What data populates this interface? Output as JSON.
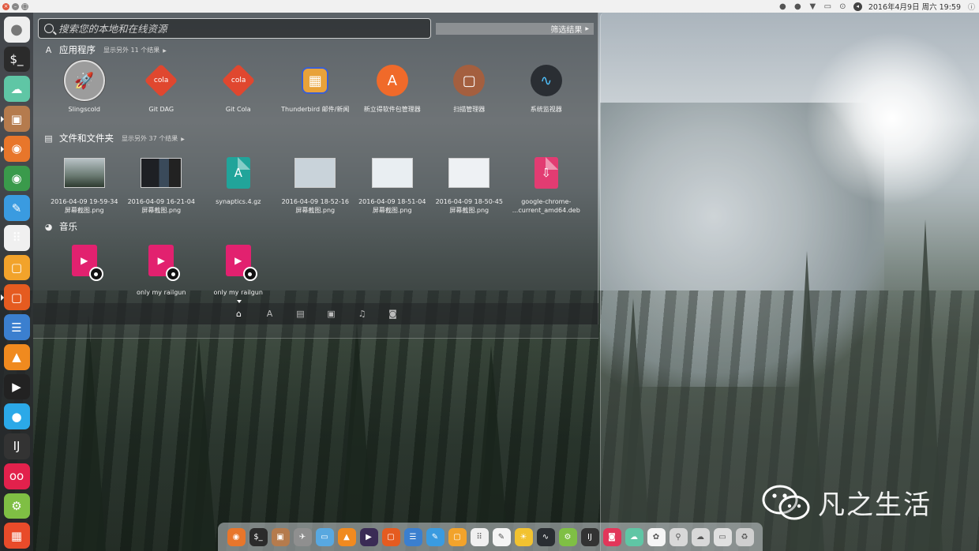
{
  "top_panel": {
    "datetime": "2016年4月9日 周六 19:59",
    "window_buttons": [
      "close-icon",
      "minimize-icon",
      "maximize-icon"
    ],
    "indicators": [
      "ime-icon",
      "chat-icon",
      "wifi-icon",
      "battery-icon",
      "input-method-icon",
      "volume-icon",
      "power-icon"
    ]
  },
  "search": {
    "placeholder": "搜索您的本地和在线资源",
    "filter_label": "筛选结果"
  },
  "applications": {
    "title": "应用程序",
    "more": "显示另外 11 个结果",
    "items": [
      {
        "label": "Slingscold",
        "icon": "rocket-icon",
        "color": "#9c9c9c"
      },
      {
        "label": "Git DAG",
        "icon": "git-icon",
        "color": "#e0472f"
      },
      {
        "label": "Git Cola",
        "icon": "git-icon",
        "color": "#e0472f"
      },
      {
        "label": "Thunderbird 邮件/新闻",
        "icon": "thunderbird-icon",
        "color": "#e8a23a"
      },
      {
        "label": "新立得软件包管理器",
        "icon": "synaptic-icon",
        "color": "#f06a2a"
      },
      {
        "label": "扫描管理器",
        "icon": "scanner-icon",
        "color": "#a45f3f"
      },
      {
        "label": "系统监视器",
        "icon": "monitor-icon",
        "color": "#2a2e33"
      }
    ]
  },
  "files": {
    "title": "文件和文件夹",
    "more": "显示另外 37 个结果",
    "items": [
      {
        "line1": "2016-04-09 19-59-34",
        "line2": "屏幕截图.png",
        "icon": "screenshot-thumbnail",
        "color": "#7d8a86"
      },
      {
        "line1": "2016-04-09 16-21-04",
        "line2": "屏幕截图.png",
        "icon": "screenshot-thumbnail",
        "color": "#2a2d33"
      },
      {
        "line1": "synaptics.4.gz",
        "line2": "",
        "icon": "archive-icon",
        "color": "#21a49a"
      },
      {
        "line1": "2016-04-09 18-52-16",
        "line2": "屏幕截图.png",
        "icon": "screenshot-thumbnail",
        "color": "#c9d3da"
      },
      {
        "line1": "2016-04-09 18-51-04",
        "line2": "屏幕截图.png",
        "icon": "screenshot-thumbnail",
        "color": "#e9eef2"
      },
      {
        "line1": "2016-04-09 18-50-45",
        "line2": "屏幕截图.png",
        "icon": "screenshot-thumbnail",
        "color": "#eef1f4"
      },
      {
        "line1": "google-chrome-",
        "line2": "...current_amd64.deb",
        "icon": "deb-package-icon",
        "color": "#e23c72"
      }
    ]
  },
  "music": {
    "title": "音乐",
    "items": [
      {
        "label": "",
        "icon": "music-file-icon"
      },
      {
        "label": "only my railgun",
        "icon": "music-file-icon"
      },
      {
        "label": "only my railgun",
        "icon": "music-file-icon"
      }
    ]
  },
  "lenses": [
    "home-lens-icon",
    "applications-lens-icon",
    "files-lens-icon",
    "video-lens-icon",
    "music-lens-icon",
    "photos-lens-icon"
  ],
  "launcher": [
    {
      "name": "dash-home-icon",
      "color": "#e8e8e8",
      "glyph": "",
      "active": false
    },
    {
      "name": "terminal-icon",
      "color": "#2b2b2b",
      "glyph": "$_",
      "active": false
    },
    {
      "name": "cloud-icon",
      "color": "#5fc6a5",
      "glyph": "☁",
      "active": false
    },
    {
      "name": "archive-manager-icon",
      "color": "#b57b4d",
      "glyph": "▣",
      "active": true
    },
    {
      "name": "firefox-icon",
      "color": "#e8762b",
      "glyph": "◉",
      "active": true
    },
    {
      "name": "chrome-icon",
      "color": "#3a9a4b",
      "glyph": "◉",
      "active": false
    },
    {
      "name": "safari-icon",
      "color": "#3a9be0",
      "glyph": "✎",
      "active": false
    },
    {
      "name": "dots-app-icon",
      "color": "#f0f0f0",
      "glyph": "⠿",
      "active": false
    },
    {
      "name": "notes-icon",
      "color": "#f2a32b",
      "glyph": "▢",
      "active": false
    },
    {
      "name": "software-center-icon",
      "color": "#e55b20",
      "glyph": "▢",
      "active": true
    },
    {
      "name": "settings-toggle-icon",
      "color": "#3b7fcf",
      "glyph": "☰",
      "active": false
    },
    {
      "name": "vlc-icon",
      "color": "#f08a1f",
      "glyph": "▲",
      "active": false
    },
    {
      "name": "media-player-icon",
      "color": "#222222",
      "glyph": "▶",
      "active": false
    },
    {
      "name": "chat-app-icon",
      "color": "#2ba9e8",
      "glyph": "●",
      "active": false
    },
    {
      "name": "intellij-icon",
      "color": "#333333",
      "glyph": "IJ",
      "active": false
    },
    {
      "name": "flickr-app-icon",
      "color": "#e2214c",
      "glyph": "oo",
      "active": false
    },
    {
      "name": "gear-app-icon",
      "color": "#7fbf44",
      "glyph": "⚙",
      "active": false
    },
    {
      "name": "windows-app-icon",
      "color": "#e84b2a",
      "glyph": "▦",
      "active": false
    }
  ],
  "dock": [
    {
      "name": "firefox-icon",
      "color": "#e8762b",
      "glyph": "◉"
    },
    {
      "name": "terminal-icon",
      "color": "#2b2b2b",
      "glyph": "$_"
    },
    {
      "name": "archive-manager-icon",
      "color": "#b57b4d",
      "glyph": "▣"
    },
    {
      "name": "launchpad-icon",
      "color": "#8f8f8f",
      "glyph": "✈"
    },
    {
      "name": "folder-icon",
      "color": "#58a8e0",
      "glyph": "▭"
    },
    {
      "name": "vlc-icon",
      "color": "#f08a1f",
      "glyph": "▲"
    },
    {
      "name": "media-player-icon",
      "color": "#3a2b55",
      "glyph": "▶"
    },
    {
      "name": "software-center-icon",
      "color": "#e55b20",
      "glyph": "▢"
    },
    {
      "name": "settings-toggle-icon",
      "color": "#3b7fcf",
      "glyph": "☰"
    },
    {
      "name": "safari-icon",
      "color": "#3a9be0",
      "glyph": "✎"
    },
    {
      "name": "notes-icon",
      "color": "#f2a32b",
      "glyph": "▢"
    },
    {
      "name": "dots-app-icon",
      "color": "#f0f0f0",
      "glyph": "⠿"
    },
    {
      "name": "textedit-icon",
      "color": "#f4f4f4",
      "glyph": "✎"
    },
    {
      "name": "weather-icon",
      "color": "#f2c230",
      "glyph": "☀"
    },
    {
      "name": "system-monitor-icon",
      "color": "#2a2e33",
      "glyph": "∿"
    },
    {
      "name": "gear-app-icon",
      "color": "#7fbf44",
      "glyph": "⚙"
    },
    {
      "name": "intellij-icon",
      "color": "#333333",
      "glyph": "IJ"
    },
    {
      "name": "camera-app-icon",
      "color": "#e2365a",
      "glyph": "◙"
    },
    {
      "name": "cloud-icon",
      "color": "#5fc6a5",
      "glyph": "☁"
    },
    {
      "name": "photos-icon",
      "color": "#f5f5f5",
      "glyph": "✿"
    },
    {
      "name": "usb-drive-icon",
      "color": "#d8d8d8",
      "glyph": "⚲"
    },
    {
      "name": "network-drive-icon",
      "color": "#d8d8d8",
      "glyph": "☁"
    },
    {
      "name": "drive-icon",
      "color": "#e0e0e0",
      "glyph": "▭"
    },
    {
      "name": "trash-icon",
      "color": "#cfcfcf",
      "glyph": "♻"
    }
  ],
  "watermark": {
    "text": "凡之生活",
    "logo": "wechat-logo-icon"
  }
}
